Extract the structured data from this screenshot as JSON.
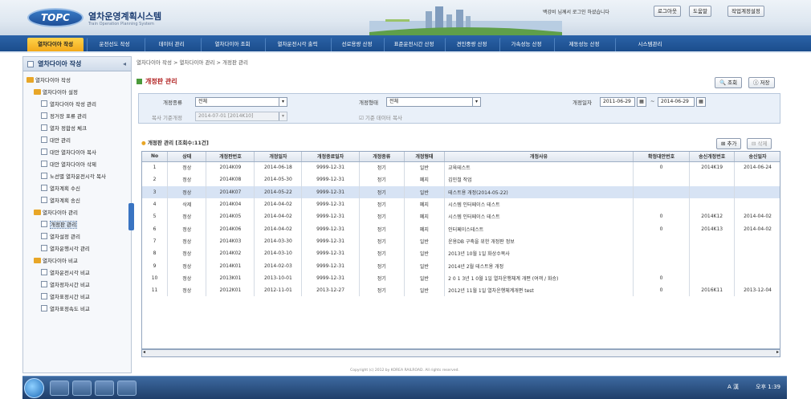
{
  "app": {
    "title": "열차운영계획시스템",
    "subtitle": "Train Operation Planning System",
    "logo": "TOPC"
  },
  "header": {
    "user_info": "백강비 님께서 로그인 하셨습니다",
    "logout": "로그아웃",
    "help": "도움말",
    "change_settings": "작업계정설정"
  },
  "nav": [
    "열차다이아 작성",
    "운전선도 작성",
    "데이터 관리",
    "열차다이아 조회",
    "열차운전시각 출력",
    "선로용량 산정",
    "표준운전시간 산정",
    "견인중량 산정",
    "가속성능 산정",
    "제동성능 산정",
    "시스템관리"
  ],
  "sidebar": {
    "title": "열차다이아 작성",
    "tree": [
      {
        "label": "열차다이아 작성",
        "level": 0,
        "type": "folder"
      },
      {
        "label": "열차다이아 설정",
        "level": 1,
        "type": "folder"
      },
      {
        "label": "열차다이아 작성 관리",
        "level": 2,
        "type": "doc"
      },
      {
        "label": "정거장 표류 관리",
        "level": 2,
        "type": "doc"
      },
      {
        "label": "열차 정합성 체크",
        "level": 2,
        "type": "doc"
      },
      {
        "label": "대안 관리",
        "level": 2,
        "type": "doc"
      },
      {
        "label": "대안 열차다이아 복사",
        "level": 2,
        "type": "doc"
      },
      {
        "label": "대안 열차다이아 삭제",
        "level": 2,
        "type": "doc"
      },
      {
        "label": "노선별 열차운전시각 복사",
        "level": 2,
        "type": "doc"
      },
      {
        "label": "열차계획 수신",
        "level": 2,
        "type": "doc"
      },
      {
        "label": "열차계획 송신",
        "level": 2,
        "type": "doc"
      },
      {
        "label": "열차다이아 관리",
        "level": 1,
        "type": "folder"
      },
      {
        "label": "개정판 관리",
        "level": 2,
        "type": "doc",
        "selected": true
      },
      {
        "label": "열차설정 관리",
        "level": 2,
        "type": "doc"
      },
      {
        "label": "열차운행시각 관리",
        "level": 2,
        "type": "doc"
      },
      {
        "label": "열차다이아 비교",
        "level": 1,
        "type": "folder"
      },
      {
        "label": "열차운전시각 비교",
        "level": 2,
        "type": "doc"
      },
      {
        "label": "열차정차시간 비교",
        "level": 2,
        "type": "doc"
      },
      {
        "label": "열차표정시간 비교",
        "level": 2,
        "type": "doc"
      },
      {
        "label": "열차표정속도 비교",
        "level": 2,
        "type": "doc"
      }
    ]
  },
  "breadcrumb": "열차다이아 작성 > 열차다이아 관리 > 개정판 관리",
  "page_title": "개정판 관리",
  "actions": {
    "search": "조회",
    "save": "저장",
    "add": "추가",
    "delete": "삭제"
  },
  "filters": {
    "type_label": "개정종류",
    "type_value": "전체",
    "form_label": "개정형태",
    "form_value": "전체",
    "date_label": "개정일자",
    "date_from": "2011-06-29",
    "date_to": "2014-06-29",
    "copy_label": "복사 기준개정",
    "copy_value": "2014-07-01 [2014K10]",
    "copy_check": "기준 데이터 복사"
  },
  "list": {
    "title": "개정판 관리 [조회수:11건]",
    "columns": [
      "No",
      "상태",
      "개정판번호",
      "개정일자",
      "개정종료일자",
      "개정종류",
      "개정형태",
      "개정사유",
      "확정대안번호",
      "송신개정번호",
      "송신일자"
    ],
    "rows": [
      [
        "1",
        "정상",
        "2014K09",
        "2014-06-18",
        "9999-12-31",
        "정기",
        "일반",
        "교육테스트",
        "0",
        "2014K19",
        "2014-06-24"
      ],
      [
        "2",
        "정상",
        "2014K08",
        "2014-05-30",
        "9999-12-31",
        "정기",
        "폐지",
        "김민철 작업",
        "",
        "",
        ""
      ],
      [
        "3",
        "정상",
        "2014K07",
        "2014-05-22",
        "9999-12-31",
        "정기",
        "일반",
        "테스트용 개정(2014-05-22)",
        "",
        "",
        ""
      ],
      [
        "4",
        "삭제",
        "2014K04",
        "2014-04-02",
        "9999-12-31",
        "정기",
        "폐지",
        "시스템 인터페이스 테스트",
        "",
        "",
        ""
      ],
      [
        "5",
        "정상",
        "2014K05",
        "2014-04-02",
        "9999-12-31",
        "정기",
        "폐지",
        "시스템 인터페이스 테스트",
        "0",
        "2014K12",
        "2014-04-02"
      ],
      [
        "6",
        "정상",
        "2014K06",
        "2014-04-02",
        "9999-12-31",
        "정기",
        "폐지",
        "인터페이스테스트",
        "0",
        "2014K13",
        "2014-04-02"
      ],
      [
        "7",
        "정상",
        "2014K03",
        "2014-03-30",
        "9999-12-31",
        "정기",
        "일반",
        "운용DB 구축을 위한 개정판 정보",
        "",
        "",
        ""
      ],
      [
        "8",
        "정상",
        "2014K02",
        "2014-03-10",
        "9999-12-31",
        "정기",
        "일반",
        "2013년 10월 1일 화상수복사",
        "",
        "",
        ""
      ],
      [
        "9",
        "정상",
        "2014K01",
        "2014-02-03",
        "9999-12-31",
        "정기",
        "일반",
        "2014년 2월 테스트용 개정",
        "",
        "",
        ""
      ],
      [
        "10",
        "정상",
        "2013K01",
        "2013-10-01",
        "9999-12-31",
        "정기",
        "일반",
        "2 0 1 3년 1 0월 1일  열차운행체계  개편 (여객 / 화승)",
        "0",
        "",
        ""
      ],
      [
        "11",
        "정상",
        "2012K01",
        "2012-11-01",
        "2013-12-27",
        "정기",
        "일반",
        "2012년 11월 1일 열차운행체계개편 test",
        "0",
        "2016K11",
        "2013-12-04"
      ]
    ],
    "selected_row": 2
  },
  "footer": "Copyright (c) 2012 by KOREA RAILROAD. All rights reserved.",
  "taskbar": {
    "clock": "오후 1:39",
    "tray": "A 漢"
  }
}
